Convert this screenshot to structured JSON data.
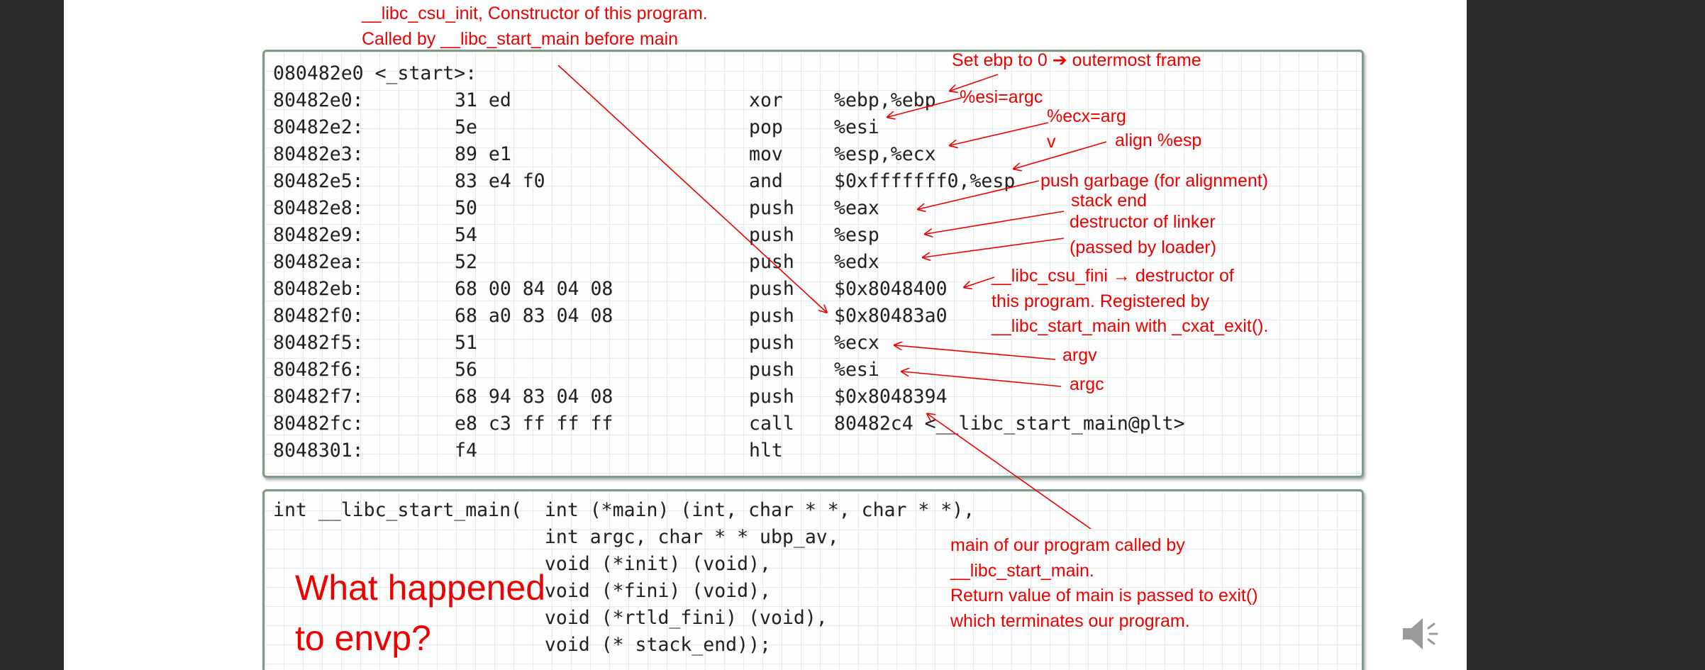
{
  "disassembly": {
    "header": "080482e0 <_start>:",
    "rows": [
      {
        "addr": "80482e0:",
        "bytes": "31 ed",
        "op": "xor",
        "args": "%ebp,%ebp"
      },
      {
        "addr": "80482e2:",
        "bytes": "5e",
        "op": "pop",
        "args": "%esi"
      },
      {
        "addr": "80482e3:",
        "bytes": "89 e1",
        "op": "mov",
        "args": "%esp,%ecx"
      },
      {
        "addr": "80482e5:",
        "bytes": "83 e4 f0",
        "op": "and",
        "args": "$0xfffffff0,%esp"
      },
      {
        "addr": "80482e8:",
        "bytes": "50",
        "op": "push",
        "args": "%eax"
      },
      {
        "addr": "80482e9:",
        "bytes": "54",
        "op": "push",
        "args": "%esp"
      },
      {
        "addr": "80482ea:",
        "bytes": "52",
        "op": "push",
        "args": "%edx"
      },
      {
        "addr": "80482eb:",
        "bytes": "68 00 84 04 08",
        "op": "push",
        "args": "$0x8048400"
      },
      {
        "addr": "80482f0:",
        "bytes": "68 a0 83 04 08",
        "op": "push",
        "args": "$0x80483a0"
      },
      {
        "addr": "80482f5:",
        "bytes": "51",
        "op": "push",
        "args": "%ecx"
      },
      {
        "addr": "80482f6:",
        "bytes": "56",
        "op": "push",
        "args": "%esi"
      },
      {
        "addr": "80482f7:",
        "bytes": "68 94 83 04 08",
        "op": "push",
        "args": "$0x8048394"
      },
      {
        "addr": "80482fc:",
        "bytes": "e8 c3 ff ff ff",
        "op": "call",
        "args": "80482c4 <__libc_start_main@plt>"
      },
      {
        "addr": "8048301:",
        "bytes": "f4",
        "op": "hlt",
        "args": ""
      }
    ]
  },
  "declaration": {
    "lines": [
      "int __libc_start_main(  int (*main) (int, char * *, char * *),",
      "                        int argc, char * * ubp_av,",
      "                        void (*init) (void),",
      "                        void (*fini) (void),",
      "                        void (*rtld_fini) (void),",
      "                        void (* stack_end));"
    ]
  },
  "annotations": {
    "csu_init": "__libc_csu_init, Constructor of this program.\nCalled by __libc_start_main before main",
    "ebp": "Set ebp to 0 ➔ outermost frame",
    "esi": "%esi=argc",
    "ecx": "%ecx=arg\nv",
    "align": "align %esp",
    "garbage": "push garbage (for alignment)",
    "stack_end": "stack end",
    "linker": "destructor of linker\n(passed by loader)",
    "csu_fini": "__libc_csu_fini → destructor of\nthis program. Registered by\n__libc_start_main with _cxat_exit().",
    "argv": "argv",
    "argc": "argc",
    "main_note": "main of our program called by\n__libc_start_main.\nReturn value of main is passed to exit()\nwhich terminates our program.",
    "envp_question": "What happened\nto envp?"
  },
  "colors": {
    "accent": "#ee0000",
    "panel_border": "#7f9a86",
    "background": "#2b2b2b"
  },
  "icons": {
    "speaker": "speaker-volume-icon"
  }
}
